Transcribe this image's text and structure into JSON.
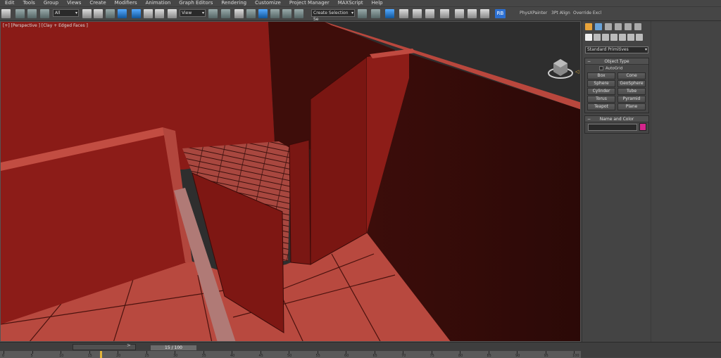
{
  "menu": [
    "Edit",
    "Tools",
    "Group",
    "Views",
    "Create",
    "Modifiers",
    "Animation",
    "Graph Editors",
    "Rendering",
    "Customize",
    "Project Manager",
    "MAXScript",
    "Help"
  ],
  "toolbar": {
    "filter_value": "All",
    "refcoord_value": "View",
    "selection_set_placeholder": "Create Selection Se",
    "rb_label": "RB",
    "plugin_labels": [
      "PhysXPainter",
      "3Pt Align",
      "Override Excl"
    ]
  },
  "viewport": {
    "label": "[+] [Perspective ] [Clay + Edged Faces ]"
  },
  "command_panel": {
    "category": "Standard Primitives",
    "object_type": {
      "title": "Object Type",
      "autogrid_label": "AutoGrid",
      "buttons": [
        "Box",
        "Cone",
        "Sphere",
        "GeoSphere",
        "Cylinder",
        "Tube",
        "Torus",
        "Pyramid",
        "Teapot",
        "Plane"
      ]
    },
    "name_color": {
      "title": "Name and Color",
      "name_value": "",
      "color": "#d4268c"
    }
  },
  "timeline": {
    "frame_display": "15 / 100",
    "ticks": [
      "0",
      "5",
      "10",
      "15",
      "20",
      "25",
      "30",
      "35",
      "40",
      "45",
      "50",
      "55",
      "60",
      "65",
      "70",
      "75",
      "80",
      "85",
      "90",
      "95",
      "100"
    ]
  },
  "colors": {
    "ui_bg": "#444444",
    "wall_red": "#8a1a16",
    "floor_red": "#b5463c",
    "accent_blue": "#2c6fd0",
    "time_marker": "#e3b43a"
  }
}
